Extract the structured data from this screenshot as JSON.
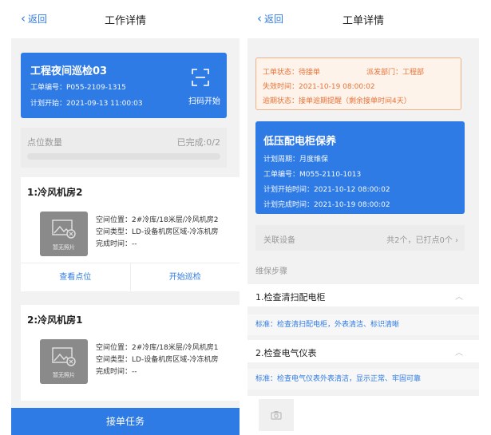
{
  "left": {
    "header": {
      "back_label": "返回",
      "title": "工作详情"
    },
    "card": {
      "name": "工程夜间巡检03",
      "order_no": "工单编号：P055-2109-1315",
      "plan_start": "计划开始：2021-09-13 11:00:03",
      "scan_label": "扫码开始"
    },
    "points": {
      "label": "点位数量",
      "done": "已完成:0/2",
      "progress": 0
    },
    "rooms": [
      {
        "title": "1:冷风机房2",
        "no_photo": "暂无照片",
        "location": "空间位置：2#冷库/18米层/冷风机房2",
        "type": "空间类型：LD-设备机房区域-冷冻机房",
        "done_time": "完成时间：--",
        "view_label": "查看点位",
        "start_label": "开始巡检"
      },
      {
        "title": "2:冷风机房1",
        "no_photo": "暂无照片",
        "location": "空间位置：2#冷库/18米层/冷风机房1",
        "type": "空间类型：LD-设备机房区域-冷冻机房",
        "done_time": "完成时间：--"
      }
    ],
    "accept_label": "接单任务"
  },
  "right": {
    "header": {
      "back_label": "返回",
      "title": "工单详情"
    },
    "status": {
      "state": "工单状态：待接单",
      "dept": "派发部门：工程部",
      "expire": "失效时间：2021-10-19 08:00:02",
      "overdue": "逾期状态：接单逾期提醒（剩余接单时间4天）"
    },
    "card": {
      "name": "低压配电柜保养",
      "cycle": "计划周期：月度维保",
      "order_no": "工单编号：M055-2110-1013",
      "start": "计划开始时间：2021-10-12 08:00:02",
      "end": "计划完成时间：2021-10-19 08:00:02"
    },
    "device": {
      "label": "关联设备",
      "value": "共2个，已打点0个"
    },
    "steps_header": "维保步骤",
    "steps": [
      {
        "title": "1.检查清扫配电柜",
        "standard": "标准：检查清扫配电柜，外表清洁、标识清晰"
      },
      {
        "title": "2.检查电气仪表",
        "standard": "标准：检查电气仪表外表清洁，显示正常、牢固可靠"
      }
    ]
  },
  "colors": {
    "primary": "#2f7be6",
    "warning": "#e8733a",
    "warning_bg": "#fdf3ea"
  }
}
